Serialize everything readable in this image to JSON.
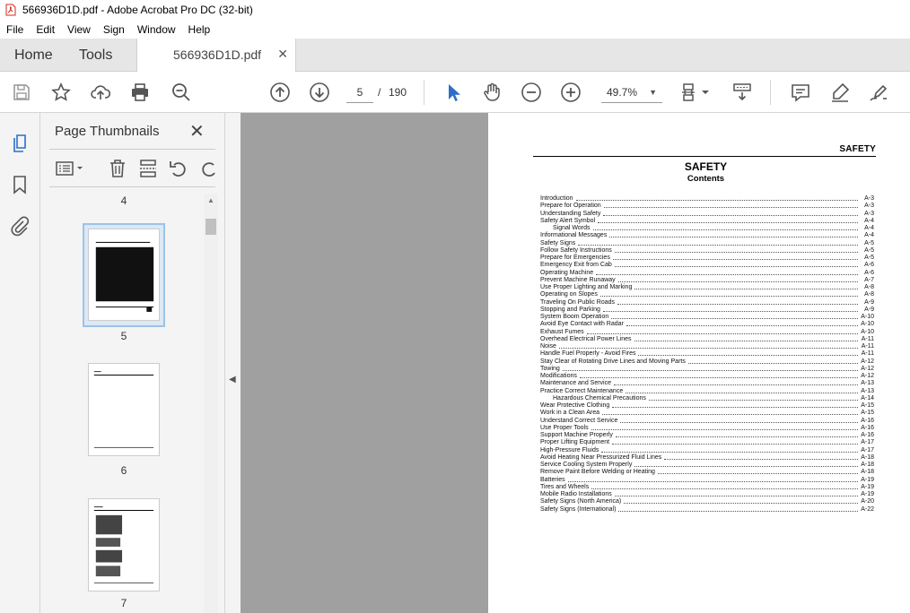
{
  "window": {
    "title": "566936D1D.pdf - Adobe Acrobat Pro DC (32-bit)"
  },
  "menu": [
    "File",
    "Edit",
    "View",
    "Sign",
    "Window",
    "Help"
  ],
  "tabs": {
    "home": "Home",
    "tools": "Tools",
    "document": "566936D1D.pdf",
    "close_glyph": "✕"
  },
  "toolbar": {
    "current_page": "5",
    "page_separator": "/",
    "total_pages": "190",
    "zoom": "49.7%",
    "zoom_caret": "▼"
  },
  "panel": {
    "title": "Page Thumbnails",
    "close_glyph": "✕",
    "thumbnail_labels": [
      "4",
      "5",
      "6",
      "7"
    ]
  },
  "page": {
    "running_header": "SAFETY",
    "title": "SAFETY",
    "subtitle": "Contents",
    "toc": [
      {
        "t": "Introduction",
        "p": "A-3"
      },
      {
        "t": "Prepare for Operation",
        "p": "A-3"
      },
      {
        "t": "Understanding Safety",
        "p": "A-3"
      },
      {
        "t": "Safety Alert Symbol",
        "p": "A-4"
      },
      {
        "t": "Signal Words",
        "p": "A-4",
        "sub": true
      },
      {
        "t": "Informational Messages",
        "p": "A-4"
      },
      {
        "t": "Safety Signs",
        "p": "A-5"
      },
      {
        "t": "Follow Safety Instructions",
        "p": "A-5"
      },
      {
        "t": "Prepare for Emergencies",
        "p": "A-5"
      },
      {
        "t": "Emergency Exit from Cab",
        "p": "A-6"
      },
      {
        "t": "Operating Machine",
        "p": "A-6"
      },
      {
        "t": "Prevent Machine Runaway",
        "p": "A-7"
      },
      {
        "t": "Use Proper Lighting and Marking",
        "p": "A-8"
      },
      {
        "t": "Operating on Slopes",
        "p": "A-8"
      },
      {
        "t": "Traveling On Public Roads",
        "p": "A-9"
      },
      {
        "t": "Stopping and Parking",
        "p": "A-9"
      },
      {
        "t": "System Boom Operation",
        "p": "A-10"
      },
      {
        "t": "Avoid Eye Contact with Radar",
        "p": "A-10"
      },
      {
        "t": "Exhaust Fumes",
        "p": "A-10"
      },
      {
        "t": "Overhead Electrical Power Lines",
        "p": "A-11"
      },
      {
        "t": "Noise",
        "p": "A-11"
      },
      {
        "t": "Handle Fuel Properly - Avoid Fires",
        "p": "A-11"
      },
      {
        "t": "Stay Clear of Rotating Drive Lines and Moving Parts",
        "p": "A-12"
      },
      {
        "t": "Towing",
        "p": "A-12"
      },
      {
        "t": "Modifications",
        "p": "A-12"
      },
      {
        "t": "Maintenance and Service",
        "p": "A-13"
      },
      {
        "t": "Practice Correct Maintenance",
        "p": "A-13"
      },
      {
        "t": "Hazardous Chemical Precautions",
        "p": "A-14",
        "sub": true
      },
      {
        "t": "Wear Protective Clothing",
        "p": "A-15"
      },
      {
        "t": "Work in a Clean Area",
        "p": "A-15"
      },
      {
        "t": "Understand Correct Service",
        "p": "A-16"
      },
      {
        "t": "Use Proper Tools",
        "p": "A-16"
      },
      {
        "t": "Support Machine Properly",
        "p": "A-16"
      },
      {
        "t": "Proper Lifting Equipment",
        "p": "A-17"
      },
      {
        "t": "High-Pressure Fluids",
        "p": "A-17"
      },
      {
        "t": "Avoid Heating Near Pressurized Fluid Lines",
        "p": "A-18"
      },
      {
        "t": "Service Cooling System Properly",
        "p": "A-18"
      },
      {
        "t": "Remove Paint Before Welding or Heating",
        "p": "A-18"
      },
      {
        "t": "Batteries",
        "p": "A-19"
      },
      {
        "t": "Tires and Wheels",
        "p": "A-19"
      },
      {
        "t": "Mobile Radio Installations",
        "p": "A-19"
      },
      {
        "t": "Safety Signs (North America)",
        "p": "A-20"
      },
      {
        "t": "Safety Signs (International)",
        "p": "A-22"
      }
    ]
  }
}
